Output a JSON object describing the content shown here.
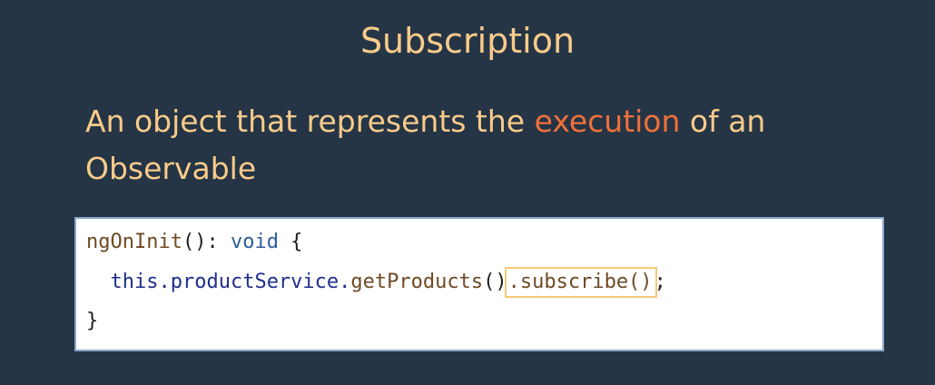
{
  "slide": {
    "title": "Subscription",
    "definition": {
      "before": "An object that represents the ",
      "highlight": "execution",
      "after": " of an Observable"
    }
  },
  "code": {
    "line1": {
      "method": "ngOnInit",
      "signature_rest": "(): ",
      "return_type": "void",
      "open_brace": " {"
    },
    "line2": {
      "indent": "  ",
      "this_kw": "this",
      "service_ref": ".productService.",
      "call": "getProducts",
      "call_parens": "()",
      "highlighted_call": ".subscribe()",
      "terminator": ";"
    },
    "line3": {
      "close_brace": "}"
    }
  },
  "colors": {
    "background": "#253545",
    "title_text": "#F9CB8A",
    "highlight_text": "#F0703A",
    "code_border": "#8AA6CB",
    "callout_border": "#F6C978"
  }
}
